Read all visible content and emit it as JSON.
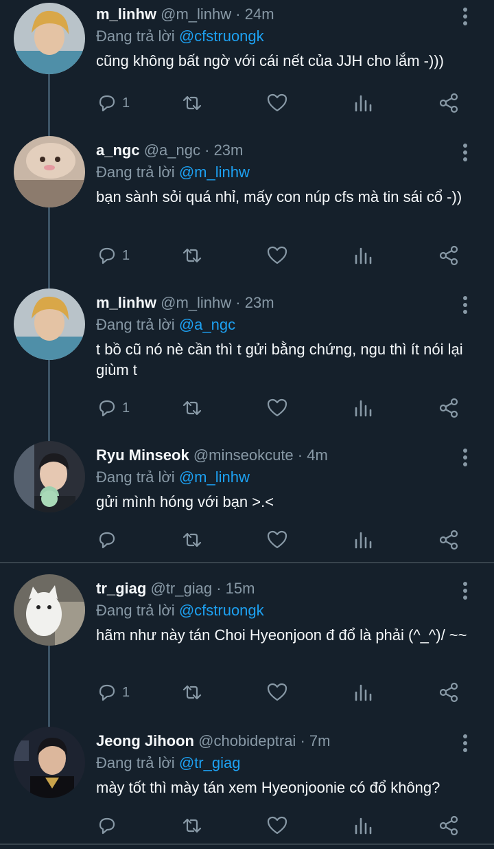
{
  "colors": {
    "background": "#15202b",
    "text": "#f5f8fa",
    "muted": "#8899a6",
    "link": "#1da1f2",
    "divider": "#38444d"
  },
  "icons": {
    "reply": "reply-icon",
    "retweet": "retweet-icon",
    "like": "heart-icon",
    "stats": "stats-icon",
    "share": "share-icon",
    "more": "more-vertical-icon"
  },
  "tweets": [
    {
      "name": "m_linhw",
      "handle": "@m_linhw",
      "time": "· 24m",
      "reply_prefix": "Đang trả lời",
      "reply_to": "@cfstruongk",
      "text": "cũng không bất ngờ với cái nết của JJH cho lắm -)))",
      "reply_count": "1"
    },
    {
      "name": "a_ngc",
      "handle": "@a_ngc",
      "time": "· 23m",
      "reply_prefix": "Đang trả lời",
      "reply_to": "@m_linhw",
      "text": "bạn sành sỏi quá nhỉ, mấy con núp cfs mà tin sái cổ -))",
      "reply_count": "1"
    },
    {
      "name": "m_linhw",
      "handle": "@m_linhw",
      "time": "· 23m",
      "reply_prefix": "Đang trả lời",
      "reply_to": "@a_ngc",
      "text": "t bồ cũ nó nè cần thì t gửi bằng chứng, ngu thì ít nói lại giùm t",
      "reply_count": "1"
    },
    {
      "name": "Ryu Minseok",
      "handle": "@minseokcute",
      "time": "· 4m",
      "reply_prefix": "Đang trả lời",
      "reply_to": "@m_linhw",
      "text": "gửi mình hóng với bạn >.<",
      "reply_count": ""
    },
    {
      "name": "tr_giag",
      "handle": "@tr_giag",
      "time": "· 15m",
      "reply_prefix": "Đang trả lời",
      "reply_to": "@cfstruongk",
      "text": "hãm như này tán Choi Hyeonjoon đ đổ là phải (^_^)/ ~~",
      "reply_count": "1"
    },
    {
      "name": "Jeong Jihoon",
      "handle": "@chobideptrai",
      "time": "· 7m",
      "reply_prefix": "Đang trả lời",
      "reply_to": "@tr_giag",
      "text": "mày tốt thì mày tán xem Hyeonjoonie có đổ không?",
      "reply_count": ""
    }
  ]
}
